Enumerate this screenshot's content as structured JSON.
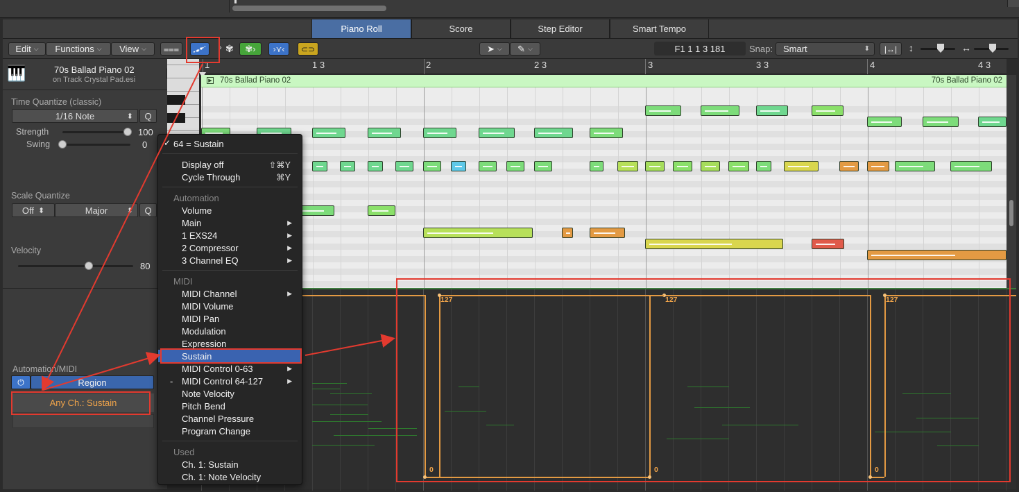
{
  "tabs": [
    {
      "label": "Piano Roll",
      "active": true
    },
    {
      "label": "Score",
      "active": false
    },
    {
      "label": "Step Editor",
      "active": false
    },
    {
      "label": "Smart Tempo",
      "active": false
    }
  ],
  "toolbar": {
    "edit": "Edit",
    "functions": "Functions",
    "view": "View",
    "position": "F1   1 1 3 181",
    "snap_label": "Snap:",
    "snap_value": "Smart"
  },
  "inspector": {
    "region_name": "70s Ballad Piano 02",
    "track_sub": "on Track Crystal Pad.esi",
    "time_quantize_label": "Time Quantize (classic)",
    "time_quantize_value": "1/16 Note",
    "q": "Q",
    "strength_label": "Strength",
    "strength_value": "100",
    "swing_label": "Swing",
    "swing_value": "0",
    "scale_quantize_label": "Scale Quantize",
    "scale_off": "Off",
    "scale_major": "Major",
    "velocity_label": "Velocity",
    "velocity_value": "80",
    "automation_label": "Automation/MIDI",
    "region_button": "Region",
    "lane_value": "Any Ch.: Sustain"
  },
  "ruler": {
    "marks": [
      "1",
      "1 3",
      "2",
      "2 3",
      "3",
      "3 3",
      "4",
      "4 3"
    ]
  },
  "region_header": {
    "left": "70s Ballad Piano 02",
    "right": "70s Ballad Piano 02"
  },
  "automation": {
    "labels_top": [
      "127",
      "127",
      "127"
    ],
    "labels_bottom": [
      "0",
      "0",
      "0"
    ]
  },
  "menu": {
    "current": "64 = Sustain",
    "display_off": "Display off",
    "display_off_shortcut": "⇧⌘Y",
    "cycle_through": "Cycle Through",
    "cycle_through_shortcut": "⌘Y",
    "automation_header": "Automation",
    "automation_items": [
      {
        "label": "Volume",
        "submenu": false
      },
      {
        "label": "Main",
        "submenu": true
      },
      {
        "label": "1 EXS24",
        "submenu": true
      },
      {
        "label": "2 Compressor",
        "submenu": true
      },
      {
        "label": "3 Channel EQ",
        "submenu": true
      }
    ],
    "midi_header": "MIDI",
    "midi_items": [
      {
        "label": "MIDI Channel",
        "submenu": true
      },
      {
        "label": "MIDI Volume",
        "submenu": false
      },
      {
        "label": "MIDI Pan",
        "submenu": false
      },
      {
        "label": "Modulation",
        "submenu": false
      },
      {
        "label": "Expression",
        "submenu": false
      },
      {
        "label": "Sustain",
        "submenu": false,
        "highlighted": true
      },
      {
        "label": "MIDI Control 0-63",
        "submenu": true
      },
      {
        "label": "MIDI Control 64-127",
        "submenu": true,
        "dash": "-"
      },
      {
        "label": "Note Velocity",
        "submenu": false
      },
      {
        "label": "Pitch Bend",
        "submenu": false
      },
      {
        "label": "Channel Pressure",
        "submenu": false
      },
      {
        "label": "Program Change",
        "submenu": false
      }
    ],
    "used_header": "Used",
    "used_items": [
      "Ch. 1: Sustain",
      "Ch. 1: Note Velocity"
    ]
  },
  "colors": {
    "accent": "#4a6ea3",
    "annotation": "#e33a2f",
    "automation_line": "#e39a43",
    "region_header": "#c9f7c2"
  }
}
